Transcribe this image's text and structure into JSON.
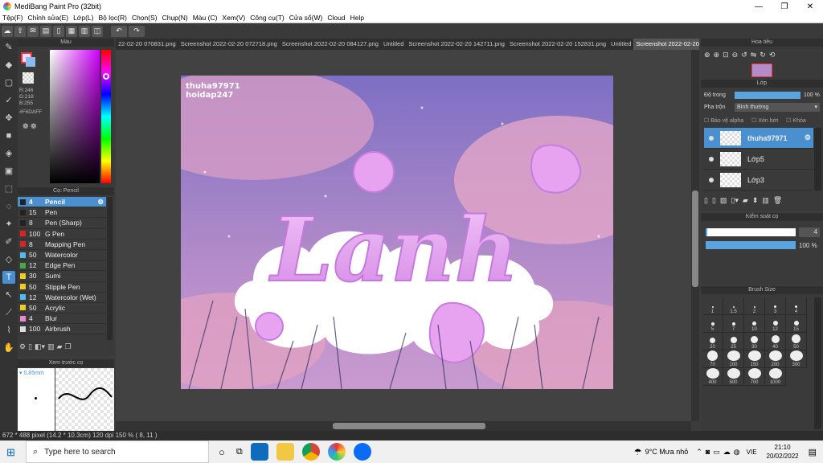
{
  "window": {
    "title": "MediBang Paint Pro (32bit)"
  },
  "menu": [
    "Tệp(F)",
    "Chỉnh sửa(E)",
    "Lớp(L)",
    "Bộ lọc(R)",
    "Chọn(S)",
    "Chụp(N)",
    "Màu (C)",
    "Xem(V)",
    "Công cụ(T)",
    "Cửa sổ(W)",
    "Cloud",
    "Help"
  ],
  "color_panel": {
    "title": "Màu",
    "r": "R:246",
    "g": "G:218",
    "b": "B:255",
    "hex": "#F6DAFF"
  },
  "brush_panel": {
    "title": "Cọ: Pencil",
    "items": [
      {
        "size": "4",
        "name": "Pencil",
        "color": "#222222"
      },
      {
        "size": "15",
        "name": "Pen",
        "color": "#222222"
      },
      {
        "size": "8",
        "name": "Pen (Sharp)",
        "color": "#222222"
      },
      {
        "size": "100",
        "name": "G Pen",
        "color": "#dd2222"
      },
      {
        "size": "8",
        "name": "Mapping Pen",
        "color": "#dd2222"
      },
      {
        "size": "50",
        "name": "Watercolor",
        "color": "#55bbee"
      },
      {
        "size": "12",
        "name": "Edge Pen",
        "color": "#44aa44"
      },
      {
        "size": "30",
        "name": "Sumi",
        "color": "#eecc22"
      },
      {
        "size": "50",
        "name": "Stipple Pen",
        "color": "#eecc22"
      },
      {
        "size": "12",
        "name": "Watercolor (Wet)",
        "color": "#55bbee"
      },
      {
        "size": "50",
        "name": "Acrylic",
        "color": "#eecc22"
      },
      {
        "size": "4",
        "name": "Blur",
        "color": "#ee88cc"
      },
      {
        "size": "100",
        "name": "Airbrush",
        "color": "#dddddd"
      }
    ]
  },
  "preview_panel": {
    "title": "Xem trước cọ",
    "size": "0.85mm"
  },
  "tabs": [
    "22-02-20 070831.png",
    "Screenshot 2022-02-20 072718.png",
    "Screenshot 2022-02-20 084127.png",
    "Untitled",
    "Screenshot 2022-02-20 142711.png",
    "Screenshot 2022-02-20 152831.png",
    "Untitled",
    "Screenshot 2022-02-20 205623.png"
  ],
  "artwork": {
    "watermark1": "thuha97971",
    "watermark2": "hoidap247",
    "text": "Lanh"
  },
  "navigator": {
    "title": "Hoa tiêu"
  },
  "layer_panel": {
    "title": "Lớp",
    "opacity_label": "Độ trong",
    "opacity_value": "100 %",
    "opacity": 1.0,
    "blend_label": "Pha trộn",
    "blend_value": "Bình thường",
    "protect_alpha": "Bảo vệ alpha",
    "clip": "Xén bớt",
    "lock": "Khóa",
    "layers": [
      {
        "name": "thuha97971",
        "selected": true
      },
      {
        "name": "Lớp5",
        "selected": false
      },
      {
        "name": "Lớp3",
        "selected": false
      }
    ]
  },
  "brush_control": {
    "title": "Kiểm soát cọ",
    "size_value": "4",
    "size_level": 0.02,
    "opacity_value": "100 %",
    "opacity_level": 1.0
  },
  "brush_size": {
    "title": "Brush Size",
    "sizes": [
      "1",
      "1.5",
      "2",
      "3",
      "4",
      "5",
      "7",
      "10",
      "12",
      "15",
      "20",
      "25",
      "30",
      "40",
      "50",
      "70",
      "100",
      "150",
      "200",
      "300",
      "400",
      "500",
      "700",
      "1000"
    ]
  },
  "status": {
    "dimensions": "672 * 488 pixel",
    "physical": "(14.2 * 10.3cm)",
    "dpi": "120 dpi",
    "zoom": "150 %",
    "coords": "( 8, 11 )"
  },
  "taskbar": {
    "search_placeholder": "Type here to search",
    "weather": "9°C Mưa nhỏ",
    "lang": "VIE",
    "time": "21:10",
    "date": "20/02/2022"
  }
}
